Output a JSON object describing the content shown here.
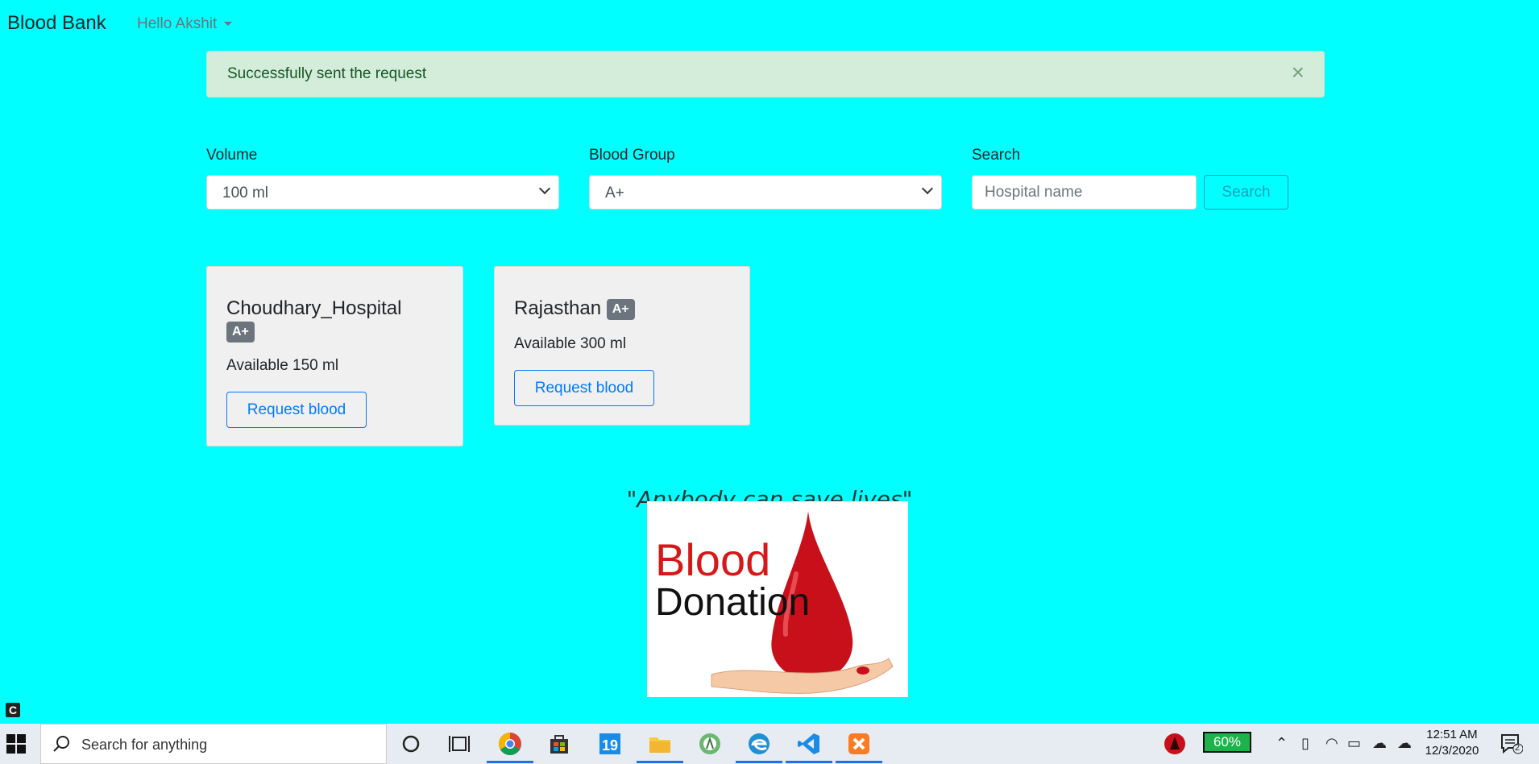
{
  "navbar": {
    "brand": "Blood Bank",
    "user_greeting": "Hello Akshit"
  },
  "alert": {
    "message": "Successfully sent the request",
    "close_label": "×"
  },
  "filters": {
    "volume_label": "Volume",
    "volume_value": "100 ml",
    "blood_group_label": "Blood Group",
    "blood_group_value": "A+",
    "search_label": "Search",
    "search_placeholder": "Hospital name",
    "search_button": "Search"
  },
  "cards": [
    {
      "name": "Choudhary_Hospital",
      "group": "A+",
      "available": "Available 150 ml",
      "button": "Request blood"
    },
    {
      "name": "Rajasthan",
      "group": "A+",
      "available": "Available 300 ml",
      "button": "Request blood"
    }
  ],
  "quote": "\"Anybody can save lives\"",
  "image": {
    "line1": "Blood",
    "line2": "Donation"
  },
  "taskbar": {
    "search_placeholder": "Search for anything",
    "battery": "60%",
    "time": "12:51 AM",
    "date": "12/3/2020",
    "notification_count": "2",
    "accent_color": "#1a73e8"
  },
  "theme": {
    "background": "#00ffff",
    "alert_bg": "#d4edda",
    "card_bg": "#f0f0f0",
    "primary": "#007bff",
    "info": "#17a2b8"
  }
}
